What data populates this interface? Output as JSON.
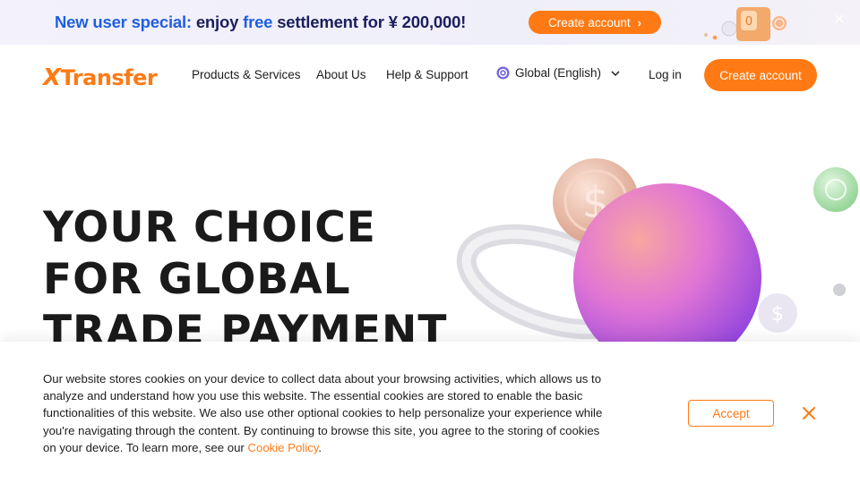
{
  "promo": {
    "segments": [
      {
        "text": "New user special:",
        "tone": "blue"
      },
      {
        "text": " enjoy ",
        "tone": "dark"
      },
      {
        "text": "free",
        "tone": "blue"
      },
      {
        "text": " settlement for ¥ 200,000!",
        "tone": "dark"
      }
    ],
    "button_label": "Create account",
    "button_icon": "chevron-right-icon",
    "close_icon": "close-icon"
  },
  "nav": {
    "logo": {
      "first": "X",
      "rest": "Transfer"
    },
    "links": [
      "Products & Services",
      "About Us",
      "Help & Support"
    ],
    "language": {
      "label": "Global (English)",
      "icon": "globe-icon",
      "caret": "chevron-down-icon"
    },
    "login": "Log in",
    "cta": "Create account"
  },
  "hero": {
    "title_lines": [
      "YOUR CHOICE",
      "FOR GLOBAL",
      "TRADE PAYMENT"
    ]
  },
  "cookie": {
    "text": "Our website stores cookies on your device to collect data about your browsing activities, which allows us to analyze and understand how you use this website. The essential cookies are stored to enable the basic functionalities of this website. We also use other optional cookies to help personalize your experience while you're navigating through the content. By continuing to browse this site, you agree to the storing of cookies on your device. To learn more, see our ",
    "link": "Cookie Policy",
    "suffix": ".",
    "accept": "Accept",
    "close_icon": "close-icon"
  },
  "colors": {
    "brand_orange": "#ff7a14",
    "promo_blue": "#1f5fe0",
    "promo_dark": "#1b1f5e",
    "headline": "#1a1a1a"
  }
}
